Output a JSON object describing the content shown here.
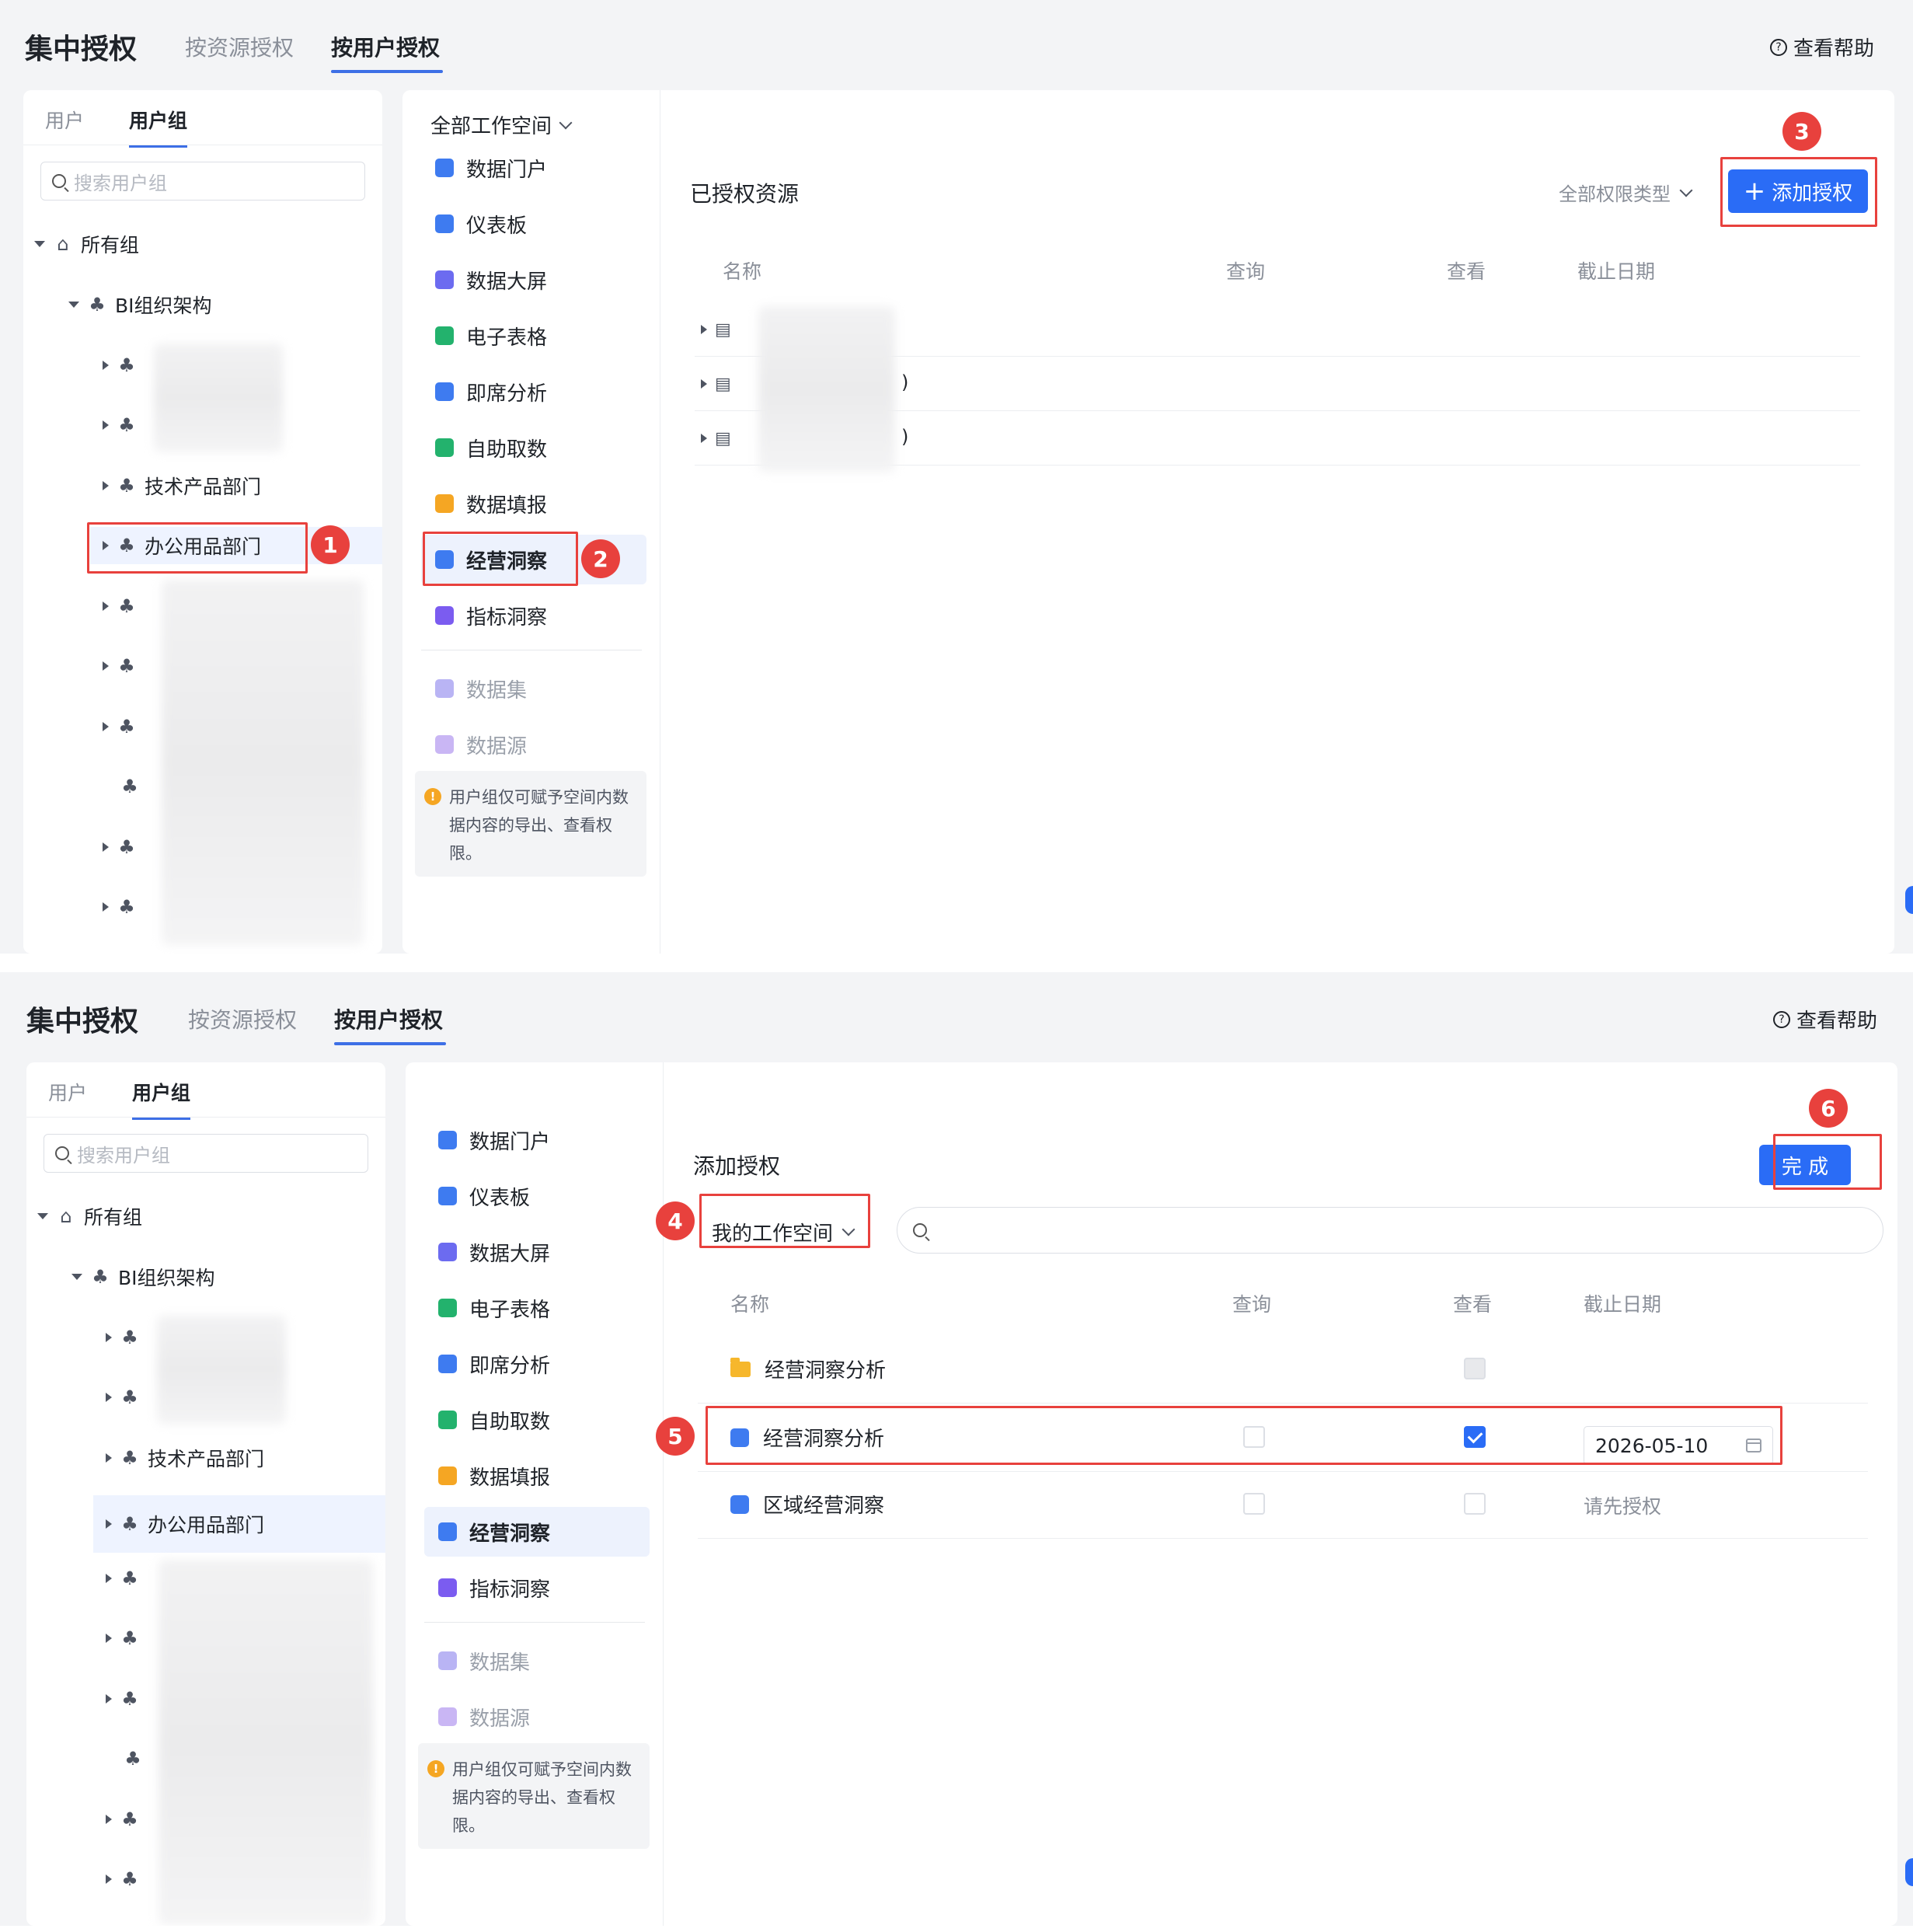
{
  "header": {
    "title": "集中授权",
    "tab_resource": "按资源授权",
    "tab_user": "按用户授权",
    "help_icon": "?",
    "help": "查看帮助"
  },
  "left": {
    "tab_user": "用户",
    "tab_group": "用户组",
    "search_placeholder": "搜索用户组",
    "root": "所有组",
    "org": "BI组织架构",
    "dept_tech": "技术产品部门",
    "dept_office": "办公用品部门"
  },
  "nav": {
    "workspace_all": "全部工作空间",
    "items": [
      "数据门户",
      "仪表板",
      "数据大屏",
      "电子表格",
      "即席分析",
      "自助取数",
      "数据填报",
      "经营洞察",
      "指标洞察"
    ],
    "disabled_items": [
      "数据集",
      "数据源"
    ],
    "tip_icon": "!",
    "tip": "用户组仅可赋予空间内数据内容的导出、查看权限。",
    "icon_colors": [
      "#3e7bf0",
      "#3e7bf0",
      "#6c6bf0",
      "#23b26d",
      "#3e7bf0",
      "#23b26d",
      "#f5a623",
      "#3e7bf0",
      "#7b5cf0"
    ]
  },
  "panel1": {
    "title": "已授权资源",
    "perm_type": "全部权限类型",
    "add_button": "添加授权",
    "add_icon": "plus-icon",
    "col_name": "名称",
    "col_query": "查询",
    "col_view": "查看",
    "col_deadline": "截止日期",
    "row_suffixes": [
      "",
      ")",
      ")"
    ]
  },
  "panel2": {
    "title": "添加授权",
    "done_button": "完 成",
    "workspace": "我的工作空间",
    "col_name": "名称",
    "col_query": "查询",
    "col_view": "查看",
    "col_deadline": "截止日期",
    "rows": [
      {
        "name": "经营洞察分析",
        "icon": "folder-icon"
      },
      {
        "name": "经营洞察分析",
        "icon": "insight-icon",
        "date": "2026-05-10"
      },
      {
        "name": "区域经营洞察",
        "icon": "insight-icon",
        "deadline_text": "请先授权"
      }
    ]
  },
  "badges": [
    "1",
    "2",
    "3",
    "4",
    "5",
    "6"
  ],
  "colors": {
    "accent": "#2a6cf6",
    "annotation": "#e8413d"
  }
}
